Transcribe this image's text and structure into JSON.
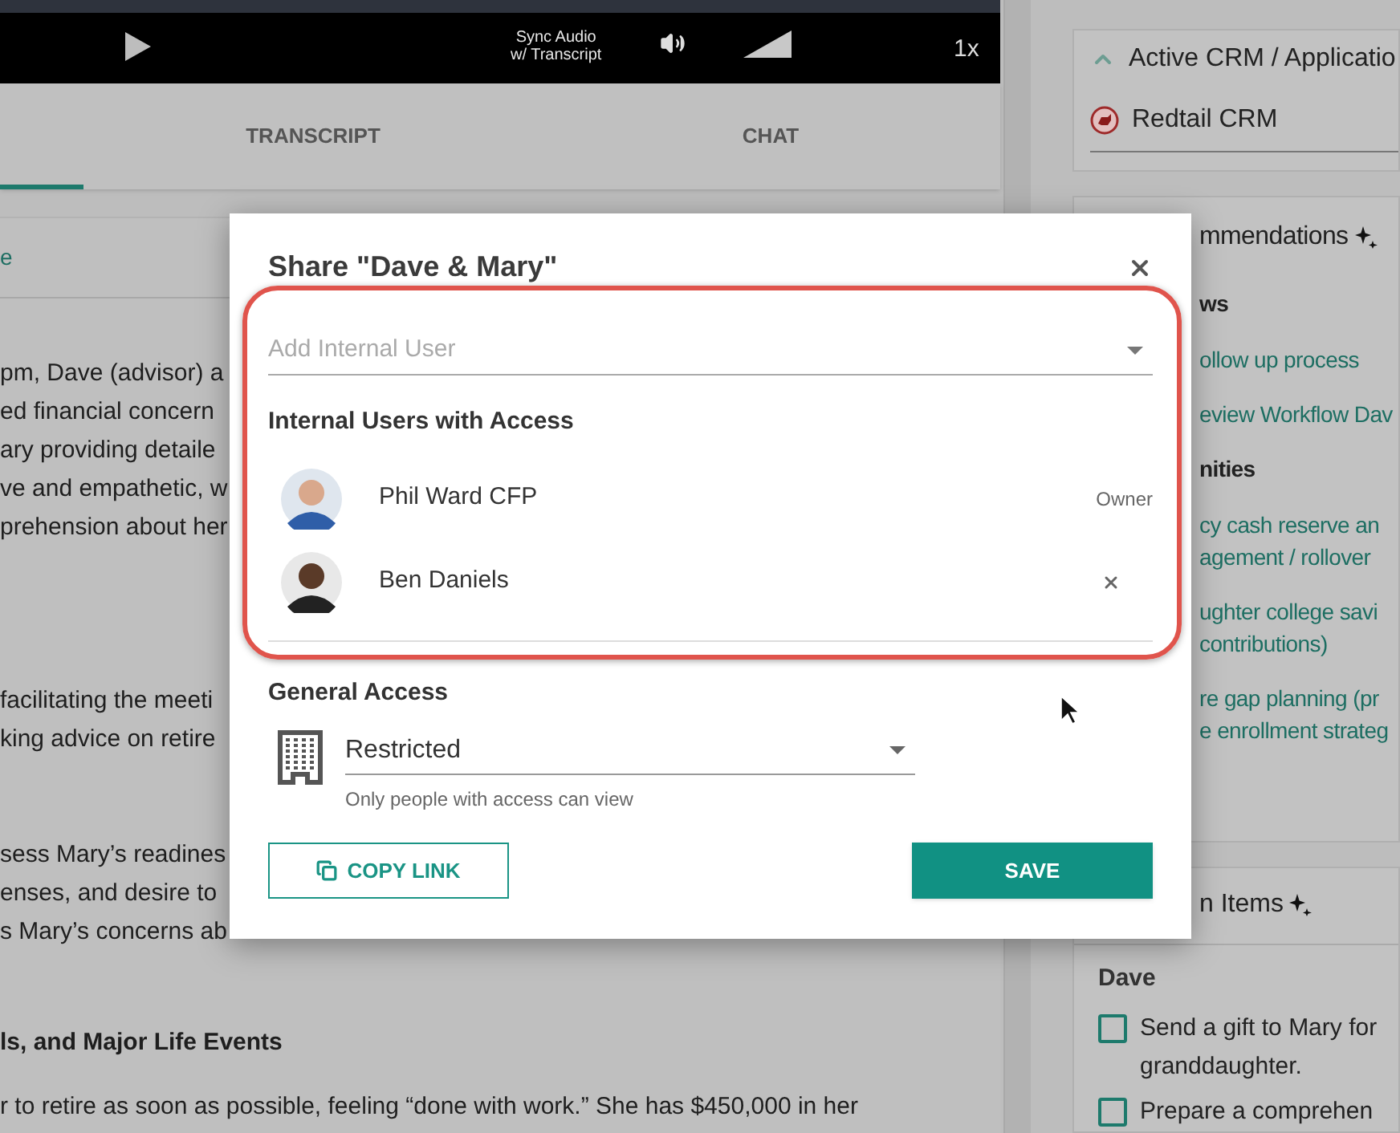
{
  "player": {
    "sync_label": [
      "Sync Audio",
      "w/ Transcript"
    ],
    "speed": "1x"
  },
  "tabs": [
    {
      "selected": true
    },
    {
      "label": "TRANSCRIPT",
      "selected": false
    },
    {
      "label": "CHAT",
      "selected": false
    }
  ],
  "summary": {
    "link": "e",
    "paragraphs": [
      [
        "pm, Dave (advisor) a",
        "ed financial concern",
        "ary providing detaile",
        "ve and empathetic, w",
        "prehension about her"
      ],
      [
        "facilitating the meeti",
        "king advice on retire"
      ],
      [
        "sess Mary’s readines",
        "enses, and desire to",
        "s Mary’s concerns ab"
      ]
    ],
    "heading": "ls, and Major Life Events",
    "last_line": "r to retire as soon as possible, feeling “done with work.” She has $450,000 in her"
  },
  "crm": {
    "title": "Active CRM / Applicatio",
    "expanded": true,
    "app": "Redtail CRM"
  },
  "recommendations": {
    "title": "mmendations",
    "sections": [
      {
        "heading": "ws",
        "items": [
          [
            "ollow up process"
          ],
          [
            "eview Workflow Dav"
          ]
        ]
      },
      {
        "heading": "nities",
        "items": [
          [
            "cy cash reserve an",
            "agement / rollover"
          ],
          [
            "ughter college savi",
            "contributions)"
          ],
          [
            "re gap planning (pr",
            "e enrollment strateg"
          ]
        ]
      }
    ]
  },
  "action_items": {
    "title": "n Items",
    "owner": "Dave",
    "items": [
      {
        "text": "Send a gift to Mary for granddaughter.",
        "checked": false
      },
      {
        "text": "Prepare a comprehen",
        "checked": false
      }
    ]
  },
  "dialog": {
    "title": "Share \"Dave & Mary\"",
    "add_user": {
      "placeholder": "Add Internal User"
    },
    "users_heading": "Internal Users with Access",
    "users": [
      {
        "name": "Phil Ward CFP",
        "kind": "owner",
        "role": "Owner"
      },
      {
        "name": "Ben Daniels",
        "kind": "member"
      }
    ],
    "general_heading": "General Access",
    "access": {
      "value": "Restricted",
      "helper": "Only people with access can view"
    },
    "buttons": [
      {
        "label": "COPY LINK",
        "kind": "outline"
      },
      {
        "label": "SAVE",
        "kind": "filled"
      }
    ]
  }
}
